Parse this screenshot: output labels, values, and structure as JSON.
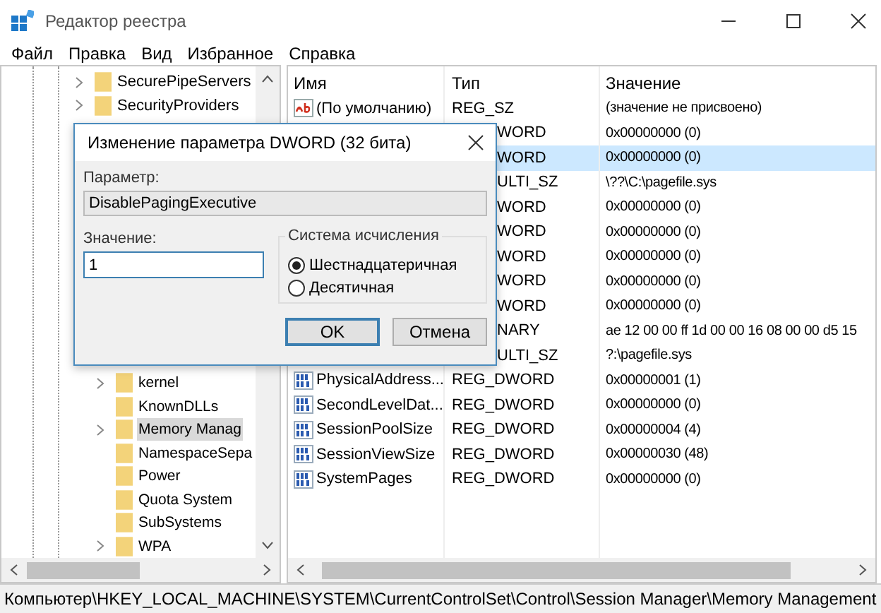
{
  "window": {
    "title": "Редактор реестра"
  },
  "menu": [
    "Файл",
    "Правка",
    "Вид",
    "Избранное",
    "Справка"
  ],
  "tree": {
    "items_top": [
      {
        "label": "SecurePipeServers",
        "expandable": true,
        "selected": false
      },
      {
        "label": "SecurityProviders",
        "expandable": true,
        "selected": false
      }
    ],
    "items_bottom": [
      {
        "label": "kernel",
        "expandable": true,
        "selected": false
      },
      {
        "label": "KnownDLLs",
        "expandable": false,
        "selected": false
      },
      {
        "label": "Memory Manag",
        "expandable": true,
        "selected": true
      },
      {
        "label": "NamespaceSepa",
        "expandable": false,
        "selected": false
      },
      {
        "label": "Power",
        "expandable": false,
        "selected": false
      },
      {
        "label": "Quota System",
        "expandable": false,
        "selected": false
      },
      {
        "label": "SubSystems",
        "expandable": false,
        "selected": false
      },
      {
        "label": "WPA",
        "expandable": true,
        "selected": false
      }
    ]
  },
  "values": {
    "columns": [
      "Имя",
      "Тип",
      "Значение"
    ],
    "rows": [
      {
        "kind": "string",
        "name": "(По умолчанию)",
        "type": "REG_SZ",
        "value": "(значение не присвоено)",
        "selected": false
      },
      {
        "kind": "covered",
        "type": "WORD",
        "value": "0x00000000 (0)",
        "selected": false
      },
      {
        "kind": "covered",
        "type": "WORD",
        "value": "0x00000000 (0)",
        "selected": true
      },
      {
        "kind": "covered",
        "type": "ULTI_SZ",
        "value": "\\??\\C:\\pagefile.sys",
        "selected": false
      },
      {
        "kind": "covered",
        "type": "WORD",
        "value": "0x00000000 (0)",
        "selected": false
      },
      {
        "kind": "covered",
        "type": "WORD",
        "value": "0x00000000 (0)",
        "selected": false
      },
      {
        "kind": "covered",
        "type": "WORD",
        "value": "0x00000000 (0)",
        "selected": false
      },
      {
        "kind": "covered",
        "type": "WORD",
        "value": "0x00000000 (0)",
        "selected": false
      },
      {
        "kind": "covered",
        "type": "WORD",
        "value": "0x00000000 (0)",
        "selected": false
      },
      {
        "kind": "covered",
        "type": "NARY",
        "value": "ae 12 00 00 ff 1d 00 00 16 08 00 00 d5 15",
        "selected": false
      },
      {
        "kind": "covered",
        "type": "ULTI_SZ",
        "value": "?:\\pagefile.sys",
        "selected": false
      },
      {
        "kind": "binary",
        "name": "PhysicalAddress...",
        "type": "REG_DWORD",
        "value": "0x00000001 (1)",
        "selected": false
      },
      {
        "kind": "binary",
        "name": "SecondLevelDat...",
        "type": "REG_DWORD",
        "value": "0x00000000 (0)",
        "selected": false
      },
      {
        "kind": "binary",
        "name": "SessionPoolSize",
        "type": "REG_DWORD",
        "value": "0x00000004 (4)",
        "selected": false
      },
      {
        "kind": "binary",
        "name": "SessionViewSize",
        "type": "REG_DWORD",
        "value": "0x00000030 (48)",
        "selected": false
      },
      {
        "kind": "binary",
        "name": "SystemPages",
        "type": "REG_DWORD",
        "value": "0x00000000 (0)",
        "selected": false
      }
    ]
  },
  "dialog": {
    "title": "Изменение параметра DWORD (32 бита)",
    "name_label": "Параметр:",
    "name_value": "DisablePagingExecutive",
    "value_label": "Значение:",
    "value": "1",
    "base_label": "Система исчисления",
    "bases": [
      {
        "label": "Шестнадцатеричная",
        "selected": true
      },
      {
        "label": "Десятичная",
        "selected": false
      }
    ],
    "buttons": [
      {
        "label": "OK",
        "default": true
      },
      {
        "label": "Отмена",
        "default": false
      }
    ]
  },
  "status_bar": "Компьютер\\HKEY_LOCAL_MACHINE\\SYSTEM\\CurrentControlSet\\Control\\Session Manager\\Memory Management"
}
